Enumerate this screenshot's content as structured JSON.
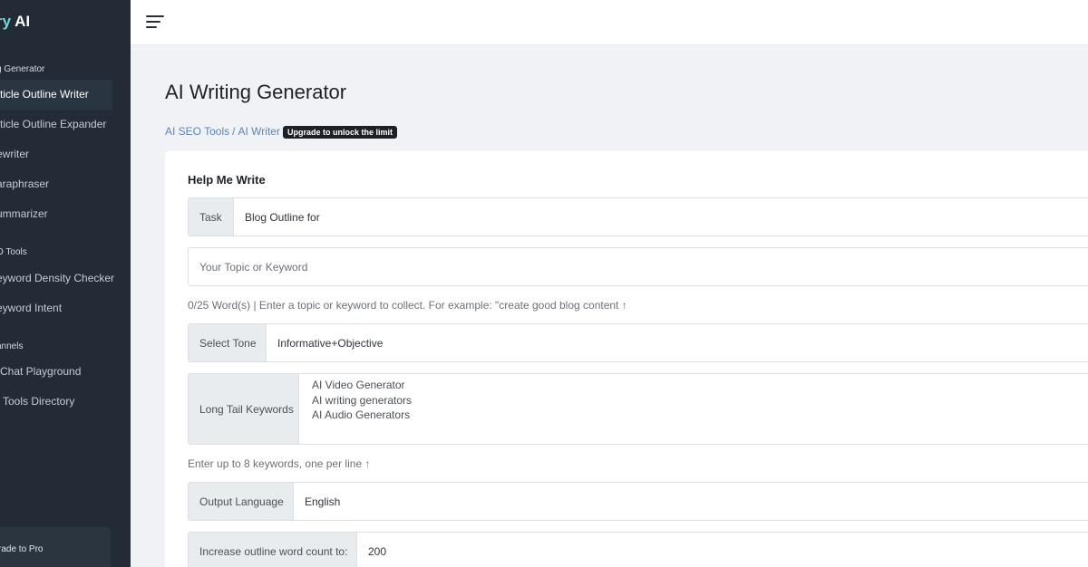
{
  "brand": {
    "accent": "ry",
    "name": "AI"
  },
  "sidebar": {
    "sections": [
      {
        "heading": "g Generator",
        "items": [
          {
            "label": "rticle Outline Writer",
            "active": true
          },
          {
            "label": "rticle Outline Expander",
            "active": false
          },
          {
            "label": "ewriter",
            "active": false
          },
          {
            "label": "araphraser",
            "active": false
          },
          {
            "label": "ummarizer",
            "active": false
          }
        ]
      },
      {
        "heading": "O Tools",
        "items": [
          {
            "label": "eyword Density Checker",
            "active": false
          },
          {
            "label": "eyword Intent",
            "active": false
          }
        ]
      },
      {
        "heading": "annels",
        "items": [
          {
            "label": "Chat Playground",
            "active": false
          },
          {
            "label": "Tools Directory",
            "active": false
          }
        ]
      }
    ],
    "upgrade_label": "rade to Pro"
  },
  "page": {
    "title": "AI Writing Generator",
    "breadcrumb": {
      "first": "AI SEO Tools",
      "sep": "/",
      "second": "AI Writer"
    },
    "badge": "Upgrade to unlock the limit"
  },
  "form": {
    "title": "Help Me Write",
    "task": {
      "label": "Task",
      "value": "Blog Outline for"
    },
    "topic": {
      "placeholder": "Your Topic or Keyword"
    },
    "topic_help": "0/25 Word(s) | Enter a topic or keyword to collect. For example: \"create good blog content ↑",
    "tone": {
      "label": "Select Tone",
      "value": "Informative+Objective"
    },
    "keywords": {
      "label": "Long Tail Keywords",
      "value": "AI Video Generator\nAI writing generators\nAI Audio Generators"
    },
    "keywords_help": "Enter up to 8 keywords, one per line ↑",
    "language": {
      "label": "Output Language",
      "value": "English"
    },
    "word_count": {
      "label": "Increase outline word count to:",
      "value": "200"
    }
  }
}
